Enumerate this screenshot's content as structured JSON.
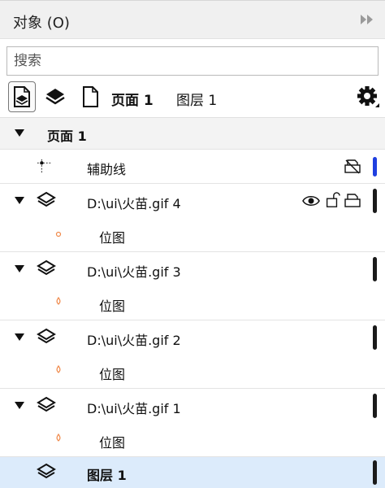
{
  "panel": {
    "title": "对象 (O)"
  },
  "search": {
    "placeholder": "搜索"
  },
  "toolbar": {
    "breadcrumb_page": "页面 1",
    "breadcrumb_layer": "图层 1",
    "icons": [
      "page-view-icon",
      "layer-view-icon",
      "page-icon",
      "settings-icon"
    ]
  },
  "tree": {
    "page_label": "页面 1",
    "guides_label": "辅助线",
    "layers": [
      {
        "name": "D:\\ui\\火苗.gif 4",
        "child": "位图",
        "bar_color": "#1a1a1a"
      },
      {
        "name": "D:\\ui\\火苗.gif 3",
        "child": "位图",
        "bar_color": "#1a1a1a"
      },
      {
        "name": "D:\\ui\\火苗.gif 2",
        "child": "位图",
        "bar_color": "#1a1a1a"
      },
      {
        "name": "D:\\ui\\火苗.gif 1",
        "child": "位图",
        "bar_color": "#1a1a1a"
      }
    ],
    "selected_layer": "图层 1",
    "guides_bar_color": "#1f3fe0"
  },
  "colors": {
    "selection": "#dcebfb",
    "guides_bar": "#1f3fe0",
    "layer_bar": "#1a1a1a",
    "thumb": "#f08a4b"
  }
}
